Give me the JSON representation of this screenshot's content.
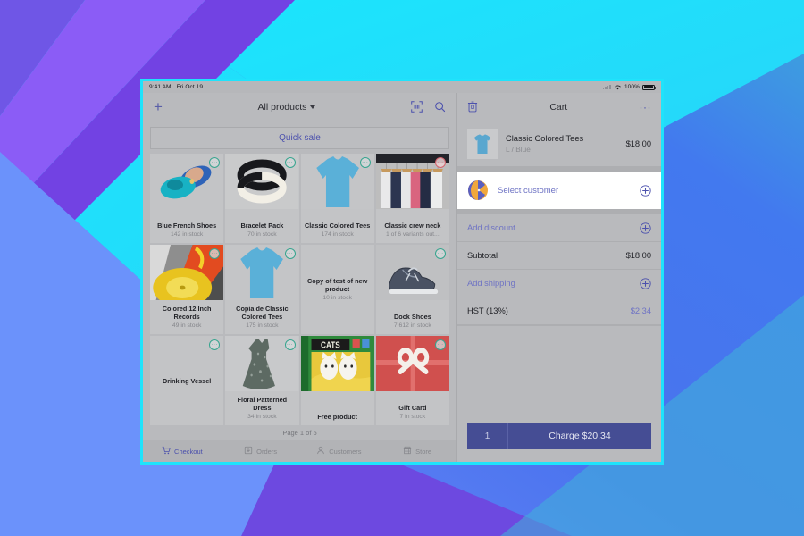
{
  "background": {
    "band_colors": [
      "#7a4fe8",
      "#8b5cf6",
      "#6d4ad6",
      "#22e0f7",
      "#19d6f5",
      "#4d7cf0",
      "#5b8cf5",
      "#3fa5dd"
    ]
  },
  "device": {
    "accent_border": "#1fe3fb",
    "statusbar": {
      "time": "9:41 AM",
      "date": "Fri Oct 19",
      "battery_percent": "100%",
      "wifi_icon": "wifi-icon",
      "battery_icon": "battery-full-icon",
      "signal_icon": "signal-dots-icon"
    }
  },
  "left": {
    "header": {
      "add_icon": "plus-icon",
      "title": "All products",
      "caret_icon": "chevron-down-icon",
      "barcode_icon": "barcode-scanner-icon",
      "search_icon": "search-icon"
    },
    "quick_sale_label": "Quick sale",
    "page_indicator": "Page 1 of 5",
    "products": [
      {
        "name": "Blue French Shoes",
        "stock": "142 in stock",
        "badge": "···",
        "badge_state": "ok",
        "image": "blue-flats"
      },
      {
        "name": "Bracelet Pack",
        "stock": "70 in stock",
        "badge": "···",
        "badge_state": "ok",
        "image": "bracelets"
      },
      {
        "name": "Classic Colored Tees",
        "stock": "174 in stock",
        "badge": "···",
        "badge_state": "ok",
        "image": "blue-tee"
      },
      {
        "name": "Classic crew neck",
        "stock": "1 of 6 variants out...",
        "badge": "···",
        "badge_state": "alert",
        "image": "hangers"
      },
      {
        "name": "Colored 12 Inch Records",
        "stock": "49 in stock",
        "badge": "···",
        "badge_state": "ok",
        "image": "records"
      },
      {
        "name": "Copia de Classic Colored Tees",
        "stock": "175 in stock",
        "badge": "···",
        "badge_state": "ok",
        "image": "blue-tee"
      },
      {
        "name": "Copy of test of new product",
        "stock": "10 in stock",
        "badge": "",
        "badge_state": "none",
        "image": "none"
      },
      {
        "name": "Dock Shoes",
        "stock": "7,612 in stock",
        "badge": "···",
        "badge_state": "ok",
        "image": "dock-shoes"
      },
      {
        "name": "Drinking Vessel",
        "stock": "",
        "badge": "···",
        "badge_state": "ok",
        "image": "none"
      },
      {
        "name": "Floral Patterned Dress",
        "stock": "34 in stock",
        "badge": "···",
        "badge_state": "ok",
        "image": "dress"
      },
      {
        "name": "Free product",
        "stock": "",
        "badge": "",
        "badge_state": "none",
        "image": "cats-book"
      },
      {
        "name": "Gift Card",
        "stock": "7 in stock",
        "badge": "···",
        "badge_state": "ok",
        "image": "gift-card"
      }
    ],
    "tabs": [
      {
        "label": "Checkout",
        "icon": "cart-icon",
        "active": true
      },
      {
        "label": "Orders",
        "icon": "orders-icon",
        "active": false
      },
      {
        "label": "Customers",
        "icon": "person-icon",
        "active": false
      },
      {
        "label": "Store",
        "icon": "store-icon",
        "active": false
      }
    ]
  },
  "right": {
    "header": {
      "trash_icon": "trash-icon",
      "title": "Cart",
      "more_icon": "more-horizontal-icon",
      "more_glyph": "···"
    },
    "cart_item": {
      "name": "Classic Colored Tees",
      "variant": "L / Blue",
      "price": "$18.00",
      "thumb_icon": "tshirt-thumbnail"
    },
    "customer_row": {
      "label": "Select customer",
      "avatar_icon": "customer-avatar-icon",
      "add_icon": "plus-circle-icon"
    },
    "lines": [
      {
        "label": "Add discount",
        "value": "",
        "style": "link",
        "add_icon": "plus-circle-icon"
      },
      {
        "label": "Subtotal",
        "value": "$18.00",
        "style": "plain",
        "add_icon": ""
      },
      {
        "label": "Add shipping",
        "value": "",
        "style": "link",
        "add_icon": "plus-circle-icon"
      },
      {
        "label": "HST (13%)",
        "value": "$2.34",
        "style": "plain",
        "value_accent": true,
        "add_icon": ""
      }
    ],
    "charge": {
      "quantity": "1",
      "label": "Charge $20.34",
      "color": "#454d94"
    }
  }
}
